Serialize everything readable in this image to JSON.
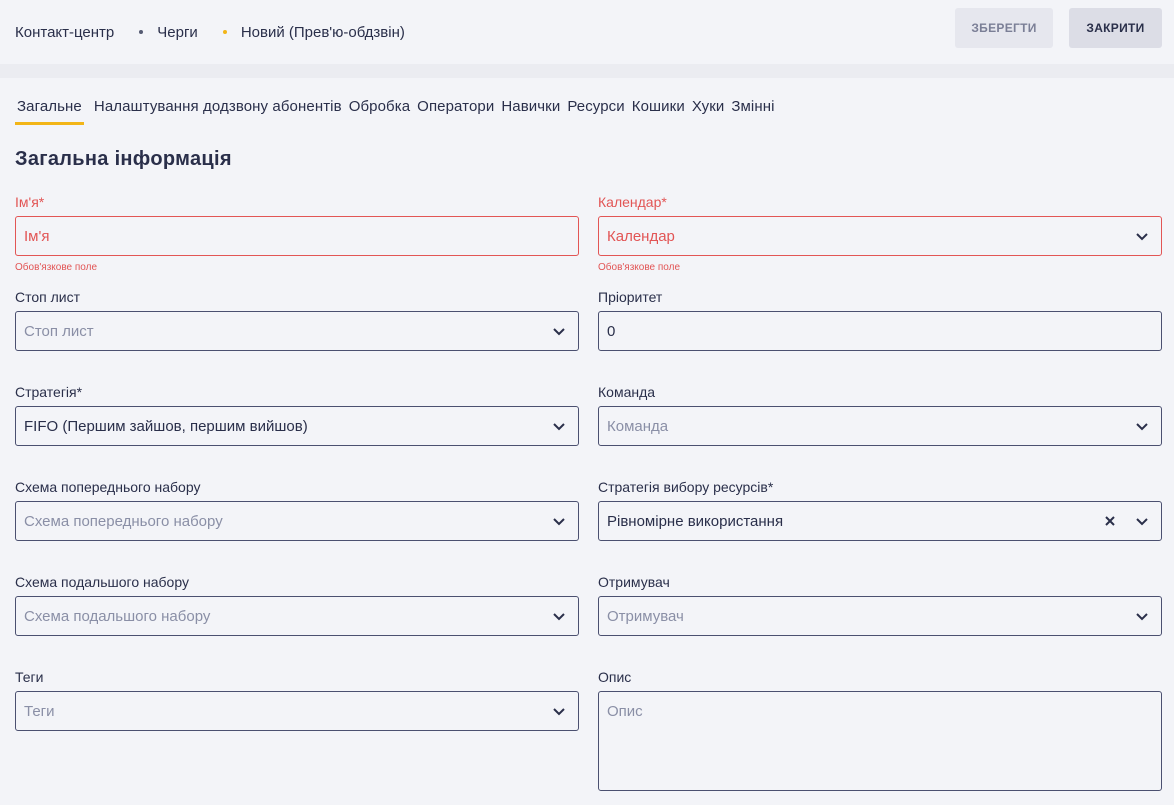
{
  "breadcrumb": {
    "items": [
      "Контакт-центр",
      "Черги",
      "Новий (Прев'ю-обдзвін)"
    ]
  },
  "actions": {
    "save": "ЗБЕРЕГТИ",
    "close": "ЗАКРИТИ"
  },
  "tabs": [
    "Загальне",
    "Налаштування додзвону абонентів",
    "Обробка",
    "Оператори",
    "Навички",
    "Ресурси",
    "Кошики",
    "Хуки",
    "Змінні"
  ],
  "active_tab": "Загальне",
  "section_title": "Загальна інформація",
  "fields": {
    "name": {
      "label": "Ім'я*",
      "placeholder": "Ім'я",
      "hint": "Обов'язкове поле"
    },
    "calendar": {
      "label": "Календар*",
      "placeholder": "Календар",
      "hint": "Обов'язкове поле"
    },
    "stoplist": {
      "label": "Стоп лист",
      "placeholder": "Стоп лист"
    },
    "priority": {
      "label": "Пріоритет",
      "value": "0"
    },
    "strategy": {
      "label": "Стратегія*",
      "value": "FIFO (Першим зайшов, першим вийшов)"
    },
    "team": {
      "label": "Команда",
      "placeholder": "Команда"
    },
    "pre_scheme": {
      "label": "Схема попереднього набору",
      "placeholder": "Схема попереднього набору"
    },
    "resource_strategy": {
      "label": "Стратегія вибору ресурсів*",
      "value": "Рівномірне використання"
    },
    "post_scheme": {
      "label": "Схема подальшого набору",
      "placeholder": "Схема подальшого набору"
    },
    "recipient": {
      "label": "Отримувач",
      "placeholder": "Отримувач"
    },
    "tags": {
      "label": "Теги",
      "placeholder": "Теги"
    },
    "description": {
      "label": "Опис",
      "placeholder": "Опис"
    }
  },
  "colors": {
    "accent": "#f2b518",
    "error": "#e25555",
    "text": "#2a2f4a",
    "border": "#4b5070"
  }
}
